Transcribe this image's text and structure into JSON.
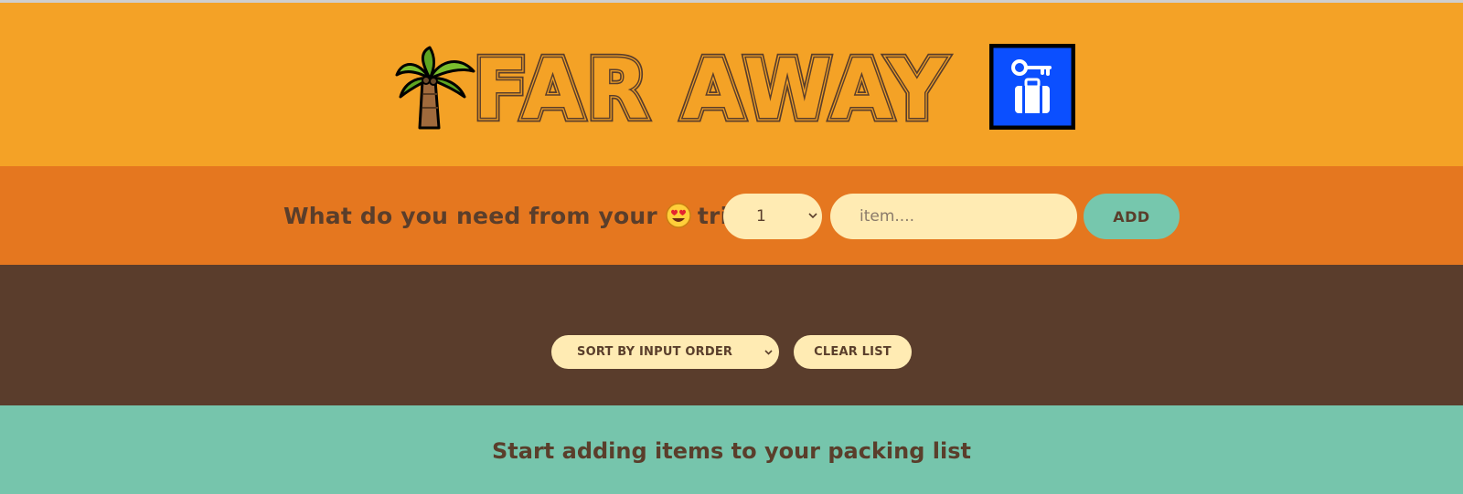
{
  "header": {
    "title": "FAR AWAY",
    "left_icon": "palm-tree-icon",
    "right_icon": "luggage-key-icon"
  },
  "form": {
    "prompt_before": "What do you need from your",
    "prompt_emoji": "heart-eyes-emoji",
    "prompt_after": "trip?",
    "quantity_value": "1",
    "item_placeholder": "item....",
    "add_label": "ADD"
  },
  "list": {
    "sort_selected": "SORT BY INPUT ORDER",
    "clear_label": "CLEAR LIST"
  },
  "stats": {
    "message": "Start adding items to your packing list"
  },
  "colors": {
    "header_bg": "#f4a226",
    "form_bg": "#e5771f",
    "list_bg": "#5a3d2c",
    "stats_bg": "#76c5ac",
    "text_brown": "#5a3e2b",
    "input_bg": "#ffebb3",
    "accent_teal": "#76c7ad",
    "luggage_blue": "#0b4fff"
  }
}
